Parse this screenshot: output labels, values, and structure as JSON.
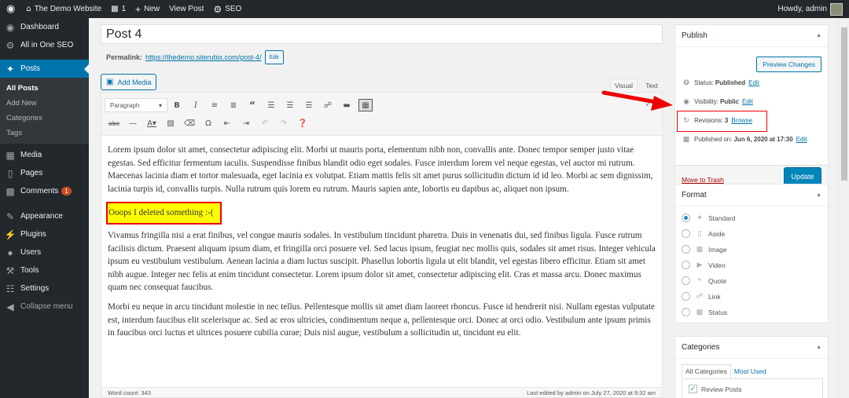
{
  "adminbar": {
    "site_name": "The Demo Website",
    "comments_count": "1",
    "new_label": "New",
    "view_post": "View Post",
    "seo": "SEO",
    "howdy": "Howdy, admin"
  },
  "sidebar": {
    "items": [
      {
        "label": "Dashboard"
      },
      {
        "label": "All in One SEO"
      },
      {
        "label": "Posts"
      },
      {
        "label": "Media"
      },
      {
        "label": "Pages"
      },
      {
        "label": "Comments",
        "badge": "1"
      },
      {
        "label": "Appearance"
      },
      {
        "label": "Plugins"
      },
      {
        "label": "Users"
      },
      {
        "label": "Tools"
      },
      {
        "label": "Settings"
      },
      {
        "label": "Collapse menu"
      }
    ],
    "submenu": [
      "All Posts",
      "Add New",
      "Categories",
      "Tags"
    ]
  },
  "post": {
    "title": "Post 4",
    "permalink_label": "Permalink:",
    "permalink_url": "https://thedemo.siterubix.com/post-4/",
    "edit_label": "Edit",
    "add_media": "Add Media",
    "tab_visual": "Visual",
    "tab_text": "Text",
    "format_select": "Paragraph",
    "paragraph1": "Lorem ipsum dolor sit amet, consectetur adipiscing elit. Morbi ut mauris porta, elementum nibh non, convallis ante. Donec tempor semper justo vitae egestas. Sed efficitur fermentum iaculis. Suspendisse finibus blandit odio eget sodales. Fusce interdum lorem vel neque egestas, vel auctor mi rutrum. Maecenas lacinia diam et tortor malesuada, eget lacinia ex volutpat. Etiam mattis felis sit amet purus sollicitudin dictum id id leo. Morbi ac sem dignissim, lacinia turpis id, convallis turpis. Nulla rutrum quis lorem eu rutrum. Mauris sapien ante, lobortis eu dapibus ac, aliquet non ipsum.",
    "highlight": "Ooops I deleted something :-(",
    "paragraph2": "Vivamus fringilla nisi a erat finibus, vel congue mauris sodales. In vestibulum tincidunt pharetra. Duis in venenatis dui, sed finibus ligula. Fusce rutrum facilisis dictum. Praesent aliquam ipsum diam, et fringilla orci posuere vel. Sed lacus ipsum, feugiat nec mollis quis, sodales sit amet risus. Integer vehicula ipsum eu vestibulum vestibulum. Aenean lacinia a diam luctus suscipit. Phasellus lobortis ligula ut elit blandit, vel egestas libero efficitur. Etiam sit amet nibh augue. Integer nec felis at enim tincidunt consectetur. Lorem ipsum dolor sit amet, consectetur adipiscing elit. Cras et massa arcu. Donec maximus quam nec consequat faucibus.",
    "paragraph3": "Morbi eu neque in arcu tincidunt molestie in nec tellus. Pellentesque mollis sit amet diam laoreet rhoncus. Fusce id hendrerit nisi. Nullam egestas vulputate est, interdum faucibus elit scelerisque ac. Sed ac eros ultricies, condimentum neque a, pellentesque orci. Donec at orci odio. Vestibulum ante ipsum primis in faucibus orci luctus et ultrices posuere cubilia curae; Duis nisl augue, vestibulum a sollicitudin ut, tincidunt eu elit.",
    "word_count": "Word count: 343",
    "last_edited": "Last edited by admin on July 27, 2020 at 9:32 am"
  },
  "publish": {
    "title": "Publish",
    "preview": "Preview Changes",
    "status_label": "Status:",
    "status_value": "Published",
    "visibility_label": "Visibility:",
    "visibility_value": "Public",
    "revisions_label": "Revisions:",
    "revisions_value": "3",
    "browse": "Browse",
    "published_label": "Published on:",
    "published_value": "Jun 6, 2020 at 17:30",
    "edit": "Edit",
    "trash": "Move to Trash",
    "update": "Update"
  },
  "format": {
    "title": "Format",
    "options": [
      "Standard",
      "Aside",
      "Image",
      "Video",
      "Quote",
      "Link",
      "Status"
    ],
    "selected": "Standard"
  },
  "categories": {
    "title": "Categories",
    "tab_all": "All Categories",
    "tab_used": "Most Used",
    "items": [
      "Review Posts"
    ]
  },
  "colors": {
    "accent": "#0073aa",
    "adminbar": "#23282d",
    "highlight": "#ffff00",
    "annotation": "#ee0000"
  }
}
